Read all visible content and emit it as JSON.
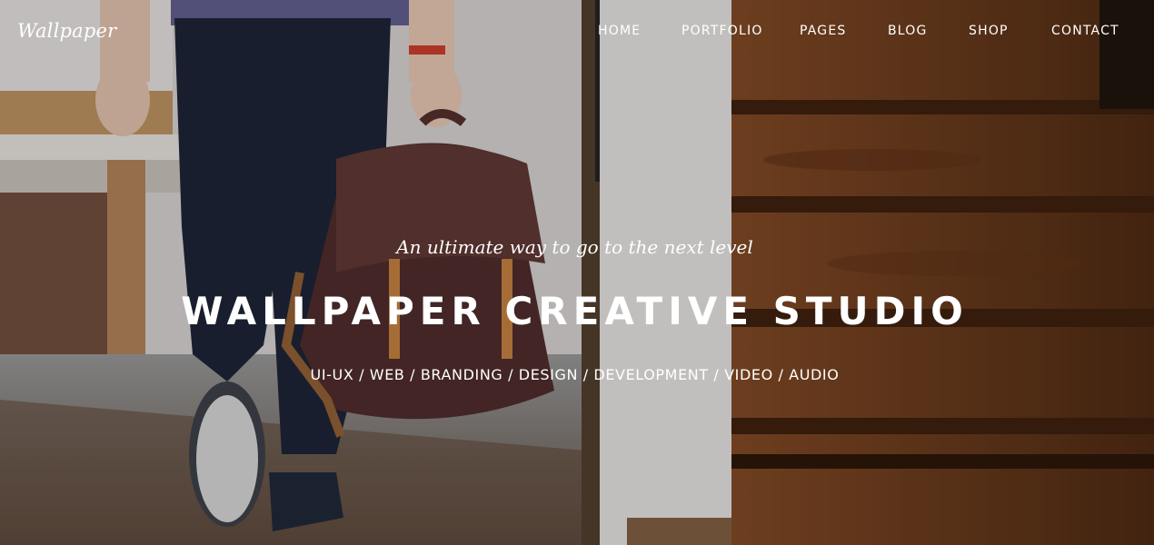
{
  "header": {
    "logo": "Wallpaper",
    "nav": [
      {
        "label": "HOME"
      },
      {
        "label": "PORTFOLIO"
      },
      {
        "label": "PAGES"
      },
      {
        "label": "BLOG"
      },
      {
        "label": "SHOP"
      },
      {
        "label": "CONTACT"
      }
    ]
  },
  "hero": {
    "tagline": "An ultimate way to go to the next level",
    "headline": "WALLPAPER CREATIVE STUDIO",
    "services": "UI-UX / WEB / BRANDING / DESIGN / DEVELOPMENT / VIDEO / AUDIO"
  }
}
